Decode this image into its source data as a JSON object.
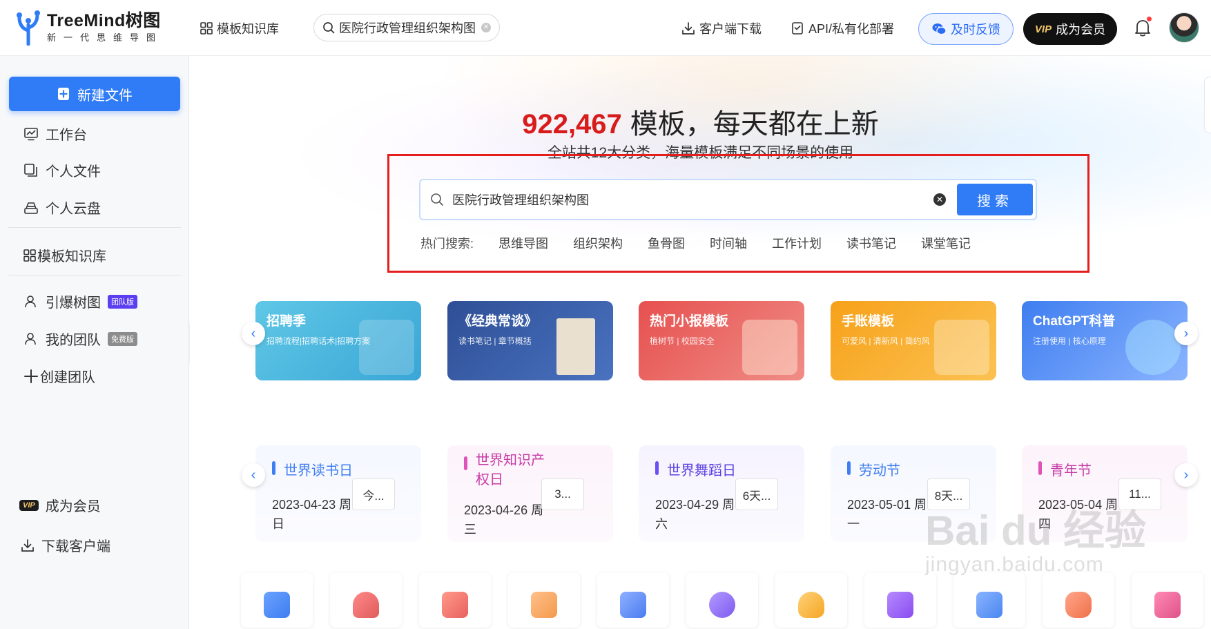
{
  "header": {
    "logo_title": "TreeMind树图",
    "logo_sub": "新一代思维导图",
    "nav_library": "模板知识库",
    "search_value": "医院行政管理组织架构图",
    "download": "客户端下载",
    "api": "API/私有化部署",
    "feedback": "及时反馈",
    "vip_tag": "VIP",
    "vip_label": "成为会员"
  },
  "sidebar": {
    "new_file": "新建文件",
    "items": [
      "工作台",
      "个人文件",
      "个人云盘"
    ],
    "library": "模板知识库",
    "team_items": [
      {
        "label": "引爆树图",
        "badge": "团队版"
      },
      {
        "label": "我的团队",
        "badge": "免费版"
      }
    ],
    "create_team": "创建团队",
    "vip_tag": "VIP",
    "vip_label": "成为会员",
    "download": "下载客户端"
  },
  "hero": {
    "count": "922,467",
    "title": "模板，每天都在上新",
    "subtitle": "全站共12大分类，海量模板满足不同场景的使用",
    "search_value": "医院行政管理组织架构图",
    "search_button": "搜索",
    "hot_label": "热门搜索:",
    "hot_tags": [
      "思维导图",
      "组织架构",
      "鱼骨图",
      "时间轴",
      "工作计划",
      "读书笔记",
      "课堂笔记"
    ]
  },
  "banners": [
    {
      "title": "招聘季",
      "sub": "招聘流程|招聘话术|招聘方案",
      "color": "#44b8d8"
    },
    {
      "title": "《经典常谈》",
      "sub": "读书笔记 | 章节概括",
      "color": "#3b5fa8"
    },
    {
      "title": "热门小报模板",
      "sub": "植树节 | 校园安全",
      "color": "#e8605e"
    },
    {
      "title": "手账模板",
      "sub": "可爱风 | 清新风 | 简约风",
      "color": "#f6a81e"
    },
    {
      "title": "ChatGPT科普",
      "sub": "注册使用 | 核心原理",
      "color": "#4a86f0"
    }
  ],
  "festivals": [
    {
      "title": "世界读书日",
      "date": "2023-04-23 周日",
      "countdown": "今...",
      "color": "#3f7df0",
      "title_color": "#3f7df0"
    },
    {
      "title": "世界知识产权日",
      "date": "2023-04-26 周三",
      "countdown": "3...",
      "color": "#e052b8",
      "title_color": "#c63ba6"
    },
    {
      "title": "世界舞蹈日",
      "date": "2023-04-29 周六",
      "countdown": "6天...",
      "color": "#6b4ff0",
      "title_color": "#5a3fe0"
    },
    {
      "title": "劳动节",
      "date": "2023-05-01 周一",
      "countdown": "8天...",
      "color": "#3f7df0",
      "title_color": "#3f7df0"
    },
    {
      "title": "青年节",
      "date": "2023-05-04 周四",
      "countdown": "11...",
      "color": "#e052b8",
      "title_color": "#c63ba6"
    }
  ],
  "categories": [
    {
      "icon": "book-icon",
      "color": "#3f7df0"
    },
    {
      "icon": "graduation-cap-icon",
      "color": "#e05b5b"
    },
    {
      "icon": "bookmark-star-icon",
      "color": "#e8605e"
    },
    {
      "icon": "id-card-icon",
      "color": "#f39a4c"
    },
    {
      "icon": "org-chart-icon",
      "color": "#4a7cf0"
    },
    {
      "icon": "planet-icon",
      "color": "#7d5af0"
    },
    {
      "icon": "lightbulb-icon",
      "color": "#f5a623"
    },
    {
      "icon": "briefcase-icon",
      "color": "#8a4cf0"
    },
    {
      "icon": "note-pen-icon",
      "color": "#4a86f0"
    },
    {
      "icon": "gamepad-icon",
      "color": "#f0704a"
    },
    {
      "icon": "apps-grid-icon",
      "color": "#e0528a"
    }
  ],
  "watermark": {
    "main": "Bai du 经验",
    "sub": "jingyan.baidu.com"
  }
}
